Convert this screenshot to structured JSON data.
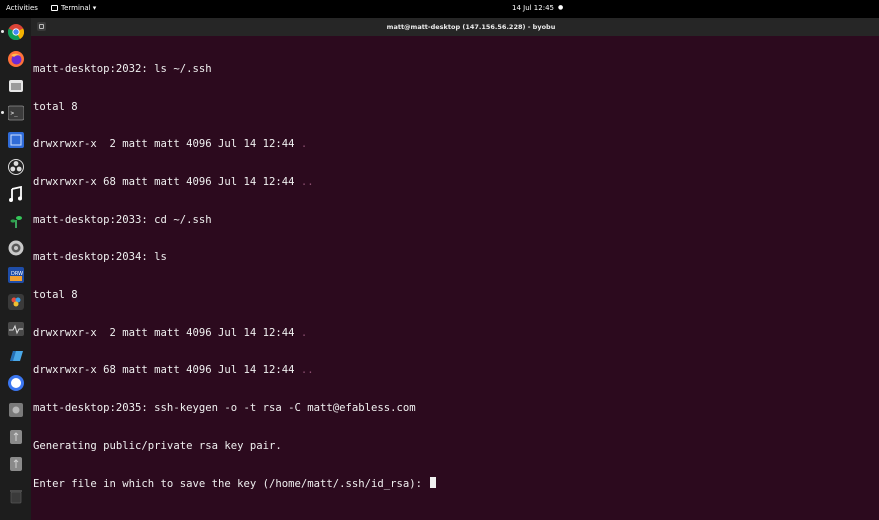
{
  "topbar": {
    "activities": "Activities",
    "app_menu_label": "Terminal ▾",
    "clock": "14 Jul 12:45",
    "clock_dot": "●"
  },
  "titlebar": {
    "title": "matt@matt-desktop (147.156.56.228) - byobu"
  },
  "terminal": {
    "lines": [
      {
        "text": "matt-desktop:2032: ls ~/.ssh",
        "dim": ""
      },
      {
        "text": "total 8",
        "dim": ""
      },
      {
        "text": "drwxrwxr-x  2 matt matt 4096 Jul 14 12:44 ",
        "dim": "."
      },
      {
        "text": "drwxrwxr-x 68 matt matt 4096 Jul 14 12:44 ",
        "dim": ".."
      },
      {
        "text": "matt-desktop:2033: cd ~/.ssh",
        "dim": ""
      },
      {
        "text": "matt-desktop:2034: ls",
        "dim": ""
      },
      {
        "text": "total 8",
        "dim": ""
      },
      {
        "text": "drwxrwxr-x  2 matt matt 4096 Jul 14 12:44 ",
        "dim": "."
      },
      {
        "text": "drwxrwxr-x 68 matt matt 4096 Jul 14 12:44 ",
        "dim": ".."
      },
      {
        "text": "matt-desktop:2035: ssh-keygen -o -t rsa -C matt@efabless.com",
        "dim": ""
      },
      {
        "text": "Generating public/private rsa key pair.",
        "dim": ""
      },
      {
        "text": "Enter file in which to save the key (/home/matt/.ssh/id_rsa): ",
        "dim": ""
      }
    ]
  },
  "dock": {
    "items": [
      {
        "name": "chrome-icon"
      },
      {
        "name": "firefox-icon"
      },
      {
        "name": "files-icon"
      },
      {
        "name": "terminal-icon"
      },
      {
        "name": "screenshot-icon"
      },
      {
        "name": "obs-icon"
      },
      {
        "name": "music-icon"
      },
      {
        "name": "plant-icon"
      },
      {
        "name": "settings-icon"
      },
      {
        "name": "drawio-icon"
      },
      {
        "name": "davinci-icon"
      },
      {
        "name": "system-monitor-icon"
      },
      {
        "name": "kicad-icon"
      },
      {
        "name": "signal-icon"
      },
      {
        "name": "disk-icon"
      },
      {
        "name": "usb-drive-icon"
      },
      {
        "name": "usb-drive-2-icon"
      },
      {
        "name": "trash-icon"
      }
    ]
  },
  "colors": {
    "terminal_bg": "#2c0a1e",
    "terminal_fg": "#f0f0f0",
    "dim_dir": "#8a4d6f",
    "dock_bg": "#1d1d1d",
    "titlebar_bg": "#262626"
  }
}
